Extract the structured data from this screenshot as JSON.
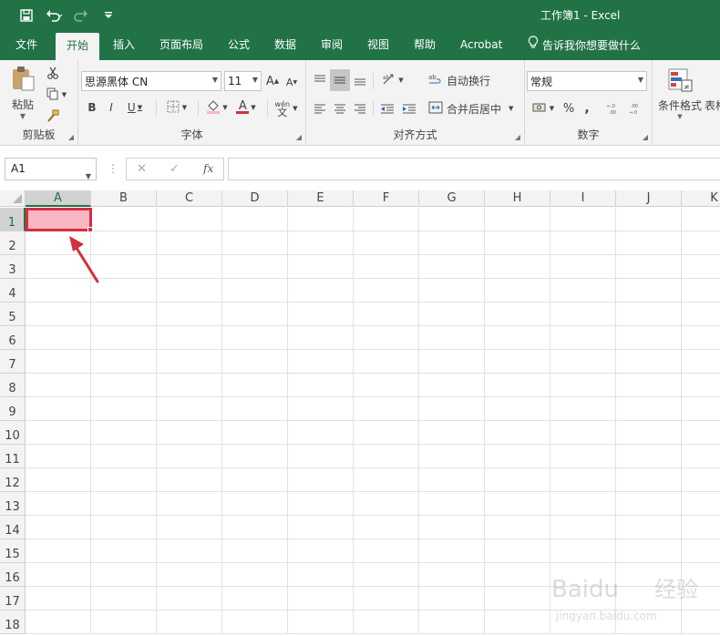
{
  "window": {
    "title": "工作簿1  -  Excel"
  },
  "qat": {
    "save_icon": "save-icon",
    "undo_icon": "undo-icon",
    "redo_icon": "redo-icon",
    "customize_icon": "chevron-down-icon"
  },
  "tabs": [
    {
      "label": "文件"
    },
    {
      "label": "开始",
      "active": true
    },
    {
      "label": "插入"
    },
    {
      "label": "页面布局"
    },
    {
      "label": "公式"
    },
    {
      "label": "数据"
    },
    {
      "label": "审阅"
    },
    {
      "label": "视图"
    },
    {
      "label": "帮助"
    },
    {
      "label": "Acrobat"
    }
  ],
  "tell_me": {
    "label": "告诉我你想要做什么",
    "icon": "lightbulb-icon"
  },
  "ribbon": {
    "clipboard": {
      "paste_label": "粘贴",
      "group_label": "剪贴板"
    },
    "font": {
      "font_name": "思源黑体 CN",
      "font_size": "11",
      "group_label": "字体",
      "wen_label": "wén",
      "wen_char": "文"
    },
    "alignment": {
      "wrap_label": "自动换行",
      "merge_label": "合并后居中",
      "group_label": "对齐方式"
    },
    "number": {
      "format": "常规",
      "group_label": "数字"
    },
    "styles": {
      "cond_format_label": "条件格式",
      "table_label": "表格"
    }
  },
  "formula_bar": {
    "name_box": "A1",
    "fx": "fx",
    "value": ""
  },
  "sheet": {
    "columns": [
      "A",
      "B",
      "C",
      "D",
      "E",
      "F",
      "G",
      "H",
      "I",
      "J",
      "K"
    ],
    "rows": [
      "1",
      "2",
      "3",
      "4",
      "5",
      "6",
      "7",
      "8",
      "9",
      "10",
      "11",
      "12",
      "13",
      "14",
      "15",
      "16",
      "17",
      "18"
    ],
    "selected_cell": "A1",
    "selected_fill": "#f7b6c2",
    "highlight_border": "#d32f3f"
  },
  "watermark": {
    "line1": "Baidu",
    "line1_cn": "经验",
    "line2": "jingyan.baidu.com"
  },
  "colors": {
    "brand": "#217346",
    "ribbon_bg": "#f3f3f3"
  }
}
